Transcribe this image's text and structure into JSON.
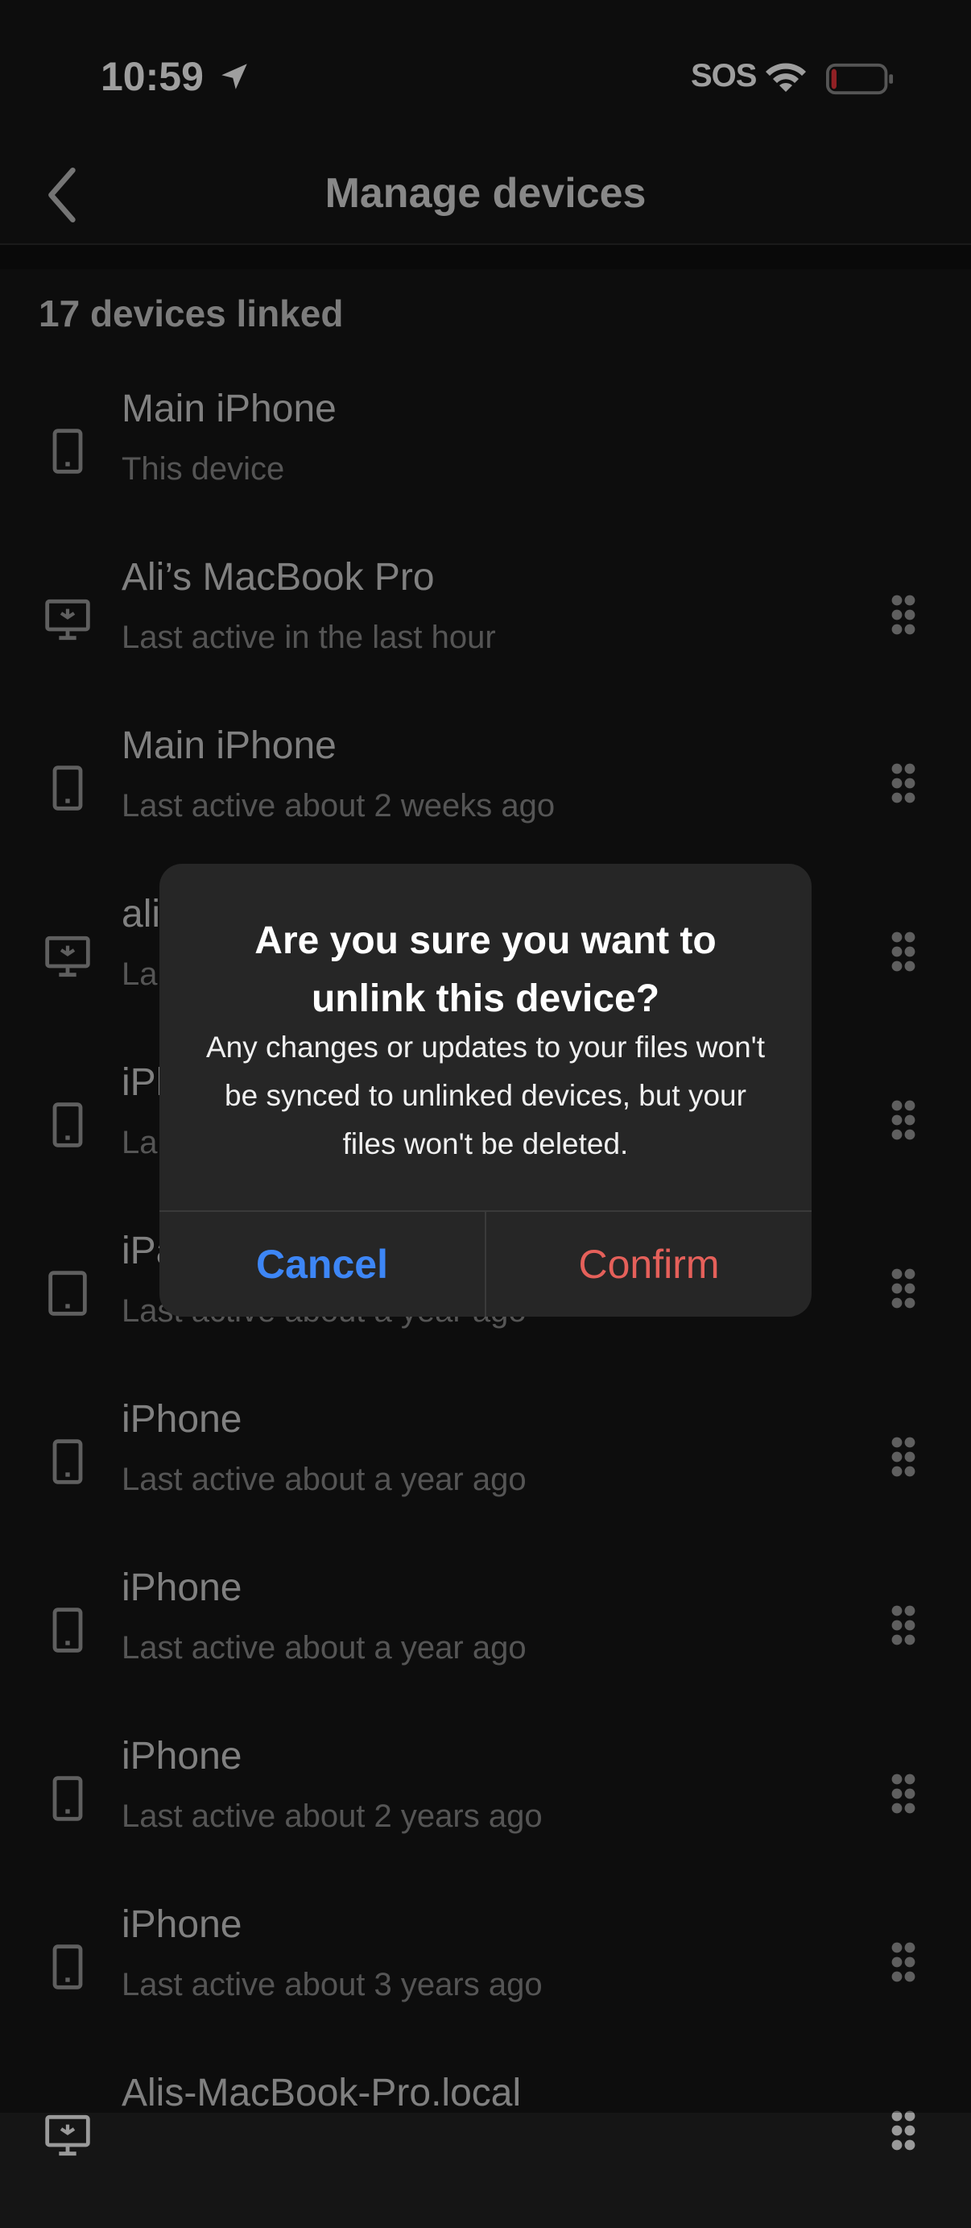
{
  "status_bar": {
    "time": "10:59",
    "signal_text": "SOS",
    "battery_level": 0.1,
    "battery_color": "#e8343a"
  },
  "nav": {
    "back_icon": "chevron-left-icon",
    "title": "Manage devices"
  },
  "devices_count_label": "17 devices linked",
  "devices": [
    {
      "type": "phone",
      "name": "Main iPhone",
      "status": "This device",
      "has_menu": false
    },
    {
      "type": "desktop",
      "name": "Ali’s MacBook Pro",
      "status": "Last active in the last hour",
      "has_menu": true
    },
    {
      "type": "phone",
      "name": "Main iPhone",
      "status": "Last active about 2 weeks ago",
      "has_menu": true
    },
    {
      "type": "desktop",
      "name": "ali",
      "status": "La",
      "has_menu": true
    },
    {
      "type": "phone",
      "name": "iPh",
      "status": "La",
      "has_menu": true
    },
    {
      "type": "tablet",
      "name": "iPa",
      "status": "Last active about a year ago",
      "has_menu": true
    },
    {
      "type": "phone",
      "name": "iPhone",
      "status": "Last active about a year ago",
      "has_menu": true
    },
    {
      "type": "phone",
      "name": "iPhone",
      "status": "Last active about a year ago",
      "has_menu": true
    },
    {
      "type": "phone",
      "name": "iPhone",
      "status": "Last active about 2 years ago",
      "has_menu": true
    },
    {
      "type": "phone",
      "name": "iPhone",
      "status": "Last active about 3 years ago",
      "has_menu": true
    },
    {
      "type": "desktop",
      "name": "Alis-MacBook-Pro.local",
      "status": "",
      "has_menu": true
    }
  ],
  "dialog": {
    "title": "Are you sure you want to unlink this device?",
    "message": "Any changes or updates to your files won't be synced to unlinked devices, but your files won't be deleted.",
    "cancel_label": "Cancel",
    "confirm_label": "Confirm",
    "cancel_color": "#3d86f6",
    "confirm_color": "#e5605a"
  }
}
